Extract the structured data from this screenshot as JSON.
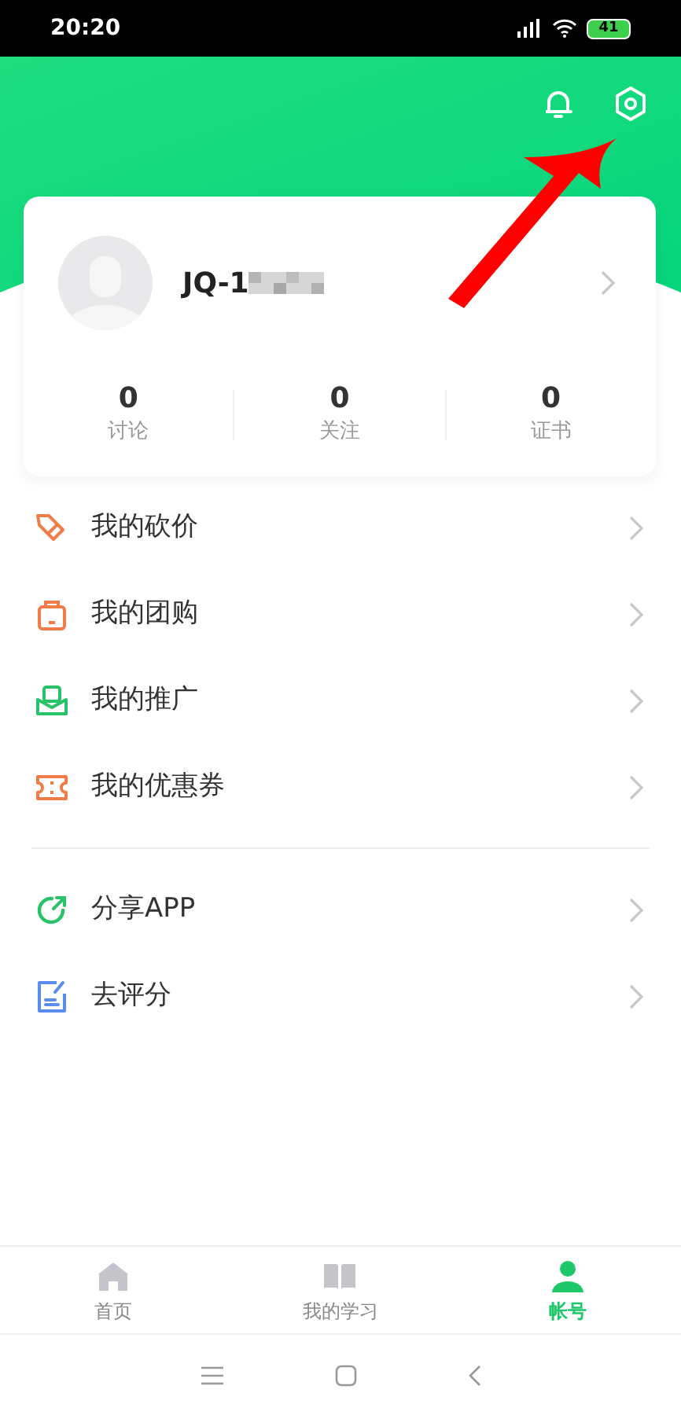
{
  "status_bar": {
    "time": "20:20",
    "battery": "41"
  },
  "profile": {
    "name": "JQ-1",
    "stats": [
      {
        "value": "0",
        "label": "讨论"
      },
      {
        "value": "0",
        "label": "关注"
      },
      {
        "value": "0",
        "label": "证书"
      }
    ]
  },
  "menu_groups": [
    [
      {
        "label": "我的砍价"
      },
      {
        "label": "我的团购"
      },
      {
        "label": "我的推广"
      },
      {
        "label": "我的优惠券"
      }
    ],
    [
      {
        "label": "分享APP"
      },
      {
        "label": "去评分"
      }
    ]
  ],
  "tabs": [
    {
      "label": "首页",
      "selected": false
    },
    {
      "label": "我的学习",
      "selected": false
    },
    {
      "label": "帐号",
      "selected": true
    }
  ]
}
